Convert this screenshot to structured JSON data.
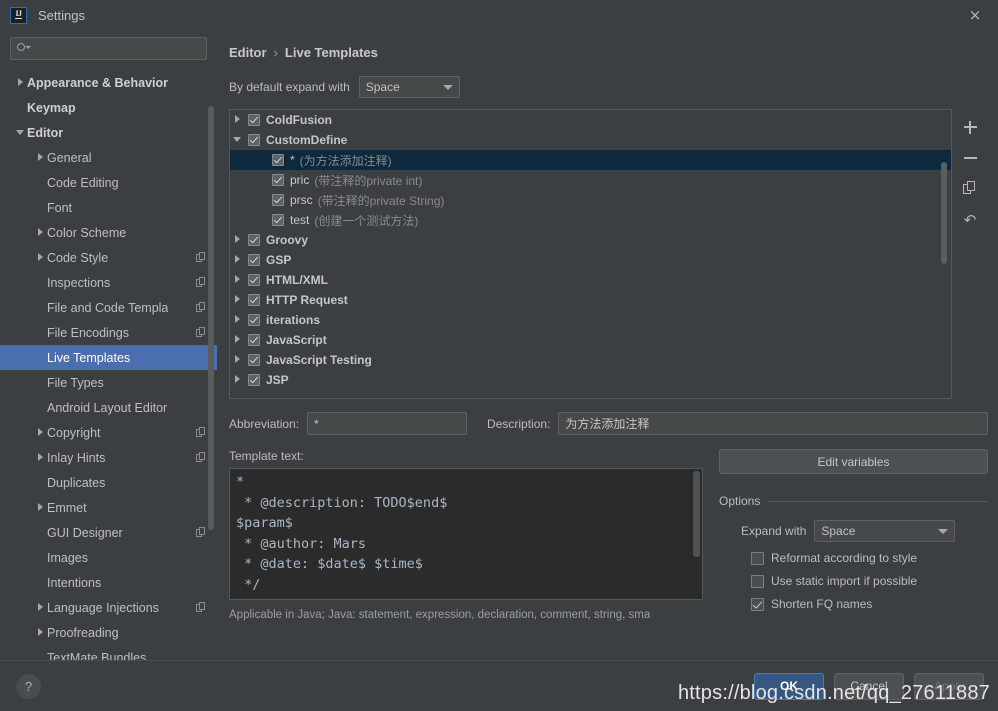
{
  "window": {
    "title": "Settings",
    "logo_text": "IJ",
    "close_icon": "×"
  },
  "sidebar": {
    "search": {
      "value": "",
      "placeholder": ""
    },
    "items": [
      {
        "label": "Appearance & Behavior",
        "arrow": "closed",
        "indent": 0,
        "bold": true,
        "selected": false,
        "copy": false
      },
      {
        "label": "Keymap",
        "arrow": "none",
        "indent": 0,
        "bold": true,
        "selected": false,
        "copy": false
      },
      {
        "label": "Editor",
        "arrow": "open",
        "indent": 0,
        "bold": true,
        "selected": false,
        "copy": false
      },
      {
        "label": "General",
        "arrow": "closed",
        "indent": 1,
        "bold": false,
        "selected": false,
        "copy": false
      },
      {
        "label": "Code Editing",
        "arrow": "none",
        "indent": 1,
        "bold": false,
        "selected": false,
        "copy": false
      },
      {
        "label": "Font",
        "arrow": "none",
        "indent": 1,
        "bold": false,
        "selected": false,
        "copy": false
      },
      {
        "label": "Color Scheme",
        "arrow": "closed",
        "indent": 1,
        "bold": false,
        "selected": false,
        "copy": false
      },
      {
        "label": "Code Style",
        "arrow": "closed",
        "indent": 1,
        "bold": false,
        "selected": false,
        "copy": true
      },
      {
        "label": "Inspections",
        "arrow": "none",
        "indent": 1,
        "bold": false,
        "selected": false,
        "copy": true
      },
      {
        "label": "File and Code Templa",
        "arrow": "none",
        "indent": 1,
        "bold": false,
        "selected": false,
        "copy": true
      },
      {
        "label": "File Encodings",
        "arrow": "none",
        "indent": 1,
        "bold": false,
        "selected": false,
        "copy": true
      },
      {
        "label": "Live Templates",
        "arrow": "none",
        "indent": 1,
        "bold": false,
        "selected": true,
        "copy": false
      },
      {
        "label": "File Types",
        "arrow": "none",
        "indent": 1,
        "bold": false,
        "selected": false,
        "copy": false
      },
      {
        "label": "Android Layout Editor",
        "arrow": "none",
        "indent": 1,
        "bold": false,
        "selected": false,
        "copy": false
      },
      {
        "label": "Copyright",
        "arrow": "closed",
        "indent": 1,
        "bold": false,
        "selected": false,
        "copy": true
      },
      {
        "label": "Inlay Hints",
        "arrow": "closed",
        "indent": 1,
        "bold": false,
        "selected": false,
        "copy": true
      },
      {
        "label": "Duplicates",
        "arrow": "none",
        "indent": 1,
        "bold": false,
        "selected": false,
        "copy": false
      },
      {
        "label": "Emmet",
        "arrow": "closed",
        "indent": 1,
        "bold": false,
        "selected": false,
        "copy": false
      },
      {
        "label": "GUI Designer",
        "arrow": "none",
        "indent": 1,
        "bold": false,
        "selected": false,
        "copy": true
      },
      {
        "label": "Images",
        "arrow": "none",
        "indent": 1,
        "bold": false,
        "selected": false,
        "copy": false
      },
      {
        "label": "Intentions",
        "arrow": "none",
        "indent": 1,
        "bold": false,
        "selected": false,
        "copy": false
      },
      {
        "label": "Language Injections",
        "arrow": "closed",
        "indent": 1,
        "bold": false,
        "selected": false,
        "copy": true
      },
      {
        "label": "Proofreading",
        "arrow": "closed",
        "indent": 1,
        "bold": false,
        "selected": false,
        "copy": false
      },
      {
        "label": "TextMate Bundles",
        "arrow": "none",
        "indent": 1,
        "bold": false,
        "selected": false,
        "copy": false
      }
    ]
  },
  "breadcrumb": {
    "root": "Editor",
    "separator": "›",
    "leaf": "Live Templates"
  },
  "expand": {
    "label": "By default expand with",
    "value": "Space"
  },
  "tree": {
    "rows": [
      {
        "arrow": "closed",
        "checked": true,
        "indent": 0,
        "name": "ColdFusion",
        "desc": "",
        "selected": false
      },
      {
        "arrow": "open",
        "checked": true,
        "indent": 0,
        "name": "CustomDefine",
        "desc": "",
        "selected": false
      },
      {
        "arrow": "none",
        "checked": true,
        "indent": 1,
        "name": "*",
        "desc": "(为方法添加注释)",
        "selected": true
      },
      {
        "arrow": "none",
        "checked": true,
        "indent": 1,
        "name": "pric",
        "desc": "(带注释的private int)",
        "selected": false
      },
      {
        "arrow": "none",
        "checked": true,
        "indent": 1,
        "name": "prsc",
        "desc": "(带注释的private String)",
        "selected": false
      },
      {
        "arrow": "none",
        "checked": true,
        "indent": 1,
        "name": "test",
        "desc": "(创建一个测试方法)",
        "selected": false
      },
      {
        "arrow": "closed",
        "checked": true,
        "indent": 0,
        "name": "Groovy",
        "desc": "",
        "selected": false
      },
      {
        "arrow": "closed",
        "checked": true,
        "indent": 0,
        "name": "GSP",
        "desc": "",
        "selected": false
      },
      {
        "arrow": "closed",
        "checked": true,
        "indent": 0,
        "name": "HTML/XML",
        "desc": "",
        "selected": false
      },
      {
        "arrow": "closed",
        "checked": true,
        "indent": 0,
        "name": "HTTP Request",
        "desc": "",
        "selected": false
      },
      {
        "arrow": "closed",
        "checked": true,
        "indent": 0,
        "name": "iterations",
        "desc": "",
        "selected": false
      },
      {
        "arrow": "closed",
        "checked": true,
        "indent": 0,
        "name": "JavaScript",
        "desc": "",
        "selected": false
      },
      {
        "arrow": "closed",
        "checked": true,
        "indent": 0,
        "name": "JavaScript Testing",
        "desc": "",
        "selected": false
      },
      {
        "arrow": "closed",
        "checked": true,
        "indent": 0,
        "name": "JSP",
        "desc": "",
        "selected": false
      }
    ],
    "toolbar": [
      {
        "icon": "plus-icon",
        "name": "add-template-button"
      },
      {
        "icon": "minus-icon",
        "name": "remove-template-button"
      },
      {
        "icon": "copy-icon",
        "name": "duplicate-template-button"
      },
      {
        "icon": "revert-icon",
        "name": "restore-defaults-button",
        "glyph": "↶"
      }
    ]
  },
  "details": {
    "abbreviation_label": "Abbreviation:",
    "abbreviation_value": "*",
    "description_label": "Description:",
    "description_value": "为方法添加注释",
    "template_text_label": "Template text:",
    "template_text": "*\n * @description: TODO$end$\n$param$\n * @author: Mars\n * @date: $date$ $time$\n */",
    "applicable": "Applicable in Java; Java: statement, expression, declaration, comment, string, sma"
  },
  "options": {
    "edit_variables_label": "Edit variables",
    "legend": "Options",
    "expand_with_label": "Expand with",
    "expand_with_value": "Space",
    "checkboxes": [
      {
        "label": "Reformat according to style",
        "checked": false
      },
      {
        "label": "Use static import if possible",
        "checked": false
      },
      {
        "label": "Shorten FQ names",
        "checked": true
      }
    ]
  },
  "footer": {
    "help_glyph": "?",
    "ok_label": "OK",
    "cancel_label": "Cancel",
    "apply_label": "Apply"
  },
  "watermark": "https://blog.csdn.net/qq_27611887",
  "colors": {
    "window_bg": "#3c3f41",
    "accent_selection": "#4b6eaf",
    "tree_selection": "#0d293e",
    "primary_button": "#365880",
    "editor_bg": "#2b2b2b",
    "code_fg": "#a9b7c6"
  }
}
